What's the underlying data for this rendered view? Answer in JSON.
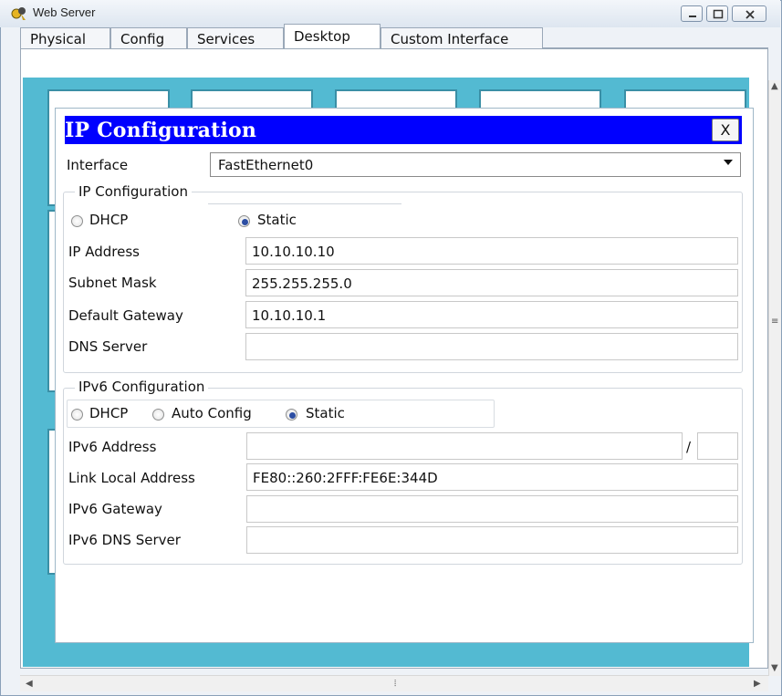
{
  "window": {
    "title": "Web Server",
    "controls": {
      "minimize": "minimize-icon",
      "maximize": "maximize-icon",
      "close": "close-icon"
    }
  },
  "tabs": [
    {
      "label": "Physical",
      "active": false
    },
    {
      "label": "Config",
      "active": false
    },
    {
      "label": "Services",
      "active": false
    },
    {
      "label": "Desktop",
      "active": true
    },
    {
      "label": "Custom Interface",
      "active": false
    }
  ],
  "dialog": {
    "title": "IP Configuration",
    "close_label": "X",
    "interface_label": "Interface",
    "interface_value": "FastEthernet0",
    "ipv4": {
      "legend": "IP Configuration",
      "dhcp_label": "DHCP",
      "static_label": "Static",
      "mode": "Static",
      "ip_address_label": "IP Address",
      "ip_address": "10.10.10.10",
      "subnet_mask_label": "Subnet Mask",
      "subnet_mask": "255.255.255.0",
      "gateway_label": "Default Gateway",
      "gateway": "10.10.10.1",
      "dns_label": "DNS Server",
      "dns": ""
    },
    "ipv6": {
      "legend": "IPv6 Configuration",
      "dhcp_label": "DHCP",
      "auto_label": "Auto Config",
      "static_label": "Static",
      "mode": "Static",
      "address_label": "IPv6 Address",
      "address": "",
      "slash": "/",
      "prefix": "",
      "link_local_label": "Link Local Address",
      "link_local": "FE80::260:2FFF:FE6E:344D",
      "gateway_label": "IPv6 Gateway",
      "gateway": "",
      "dns_label": "IPv6 DNS Server",
      "dns": ""
    }
  },
  "colors": {
    "dialog_title_bar": "#0000ff",
    "desktop_bg": "#53bad2"
  }
}
